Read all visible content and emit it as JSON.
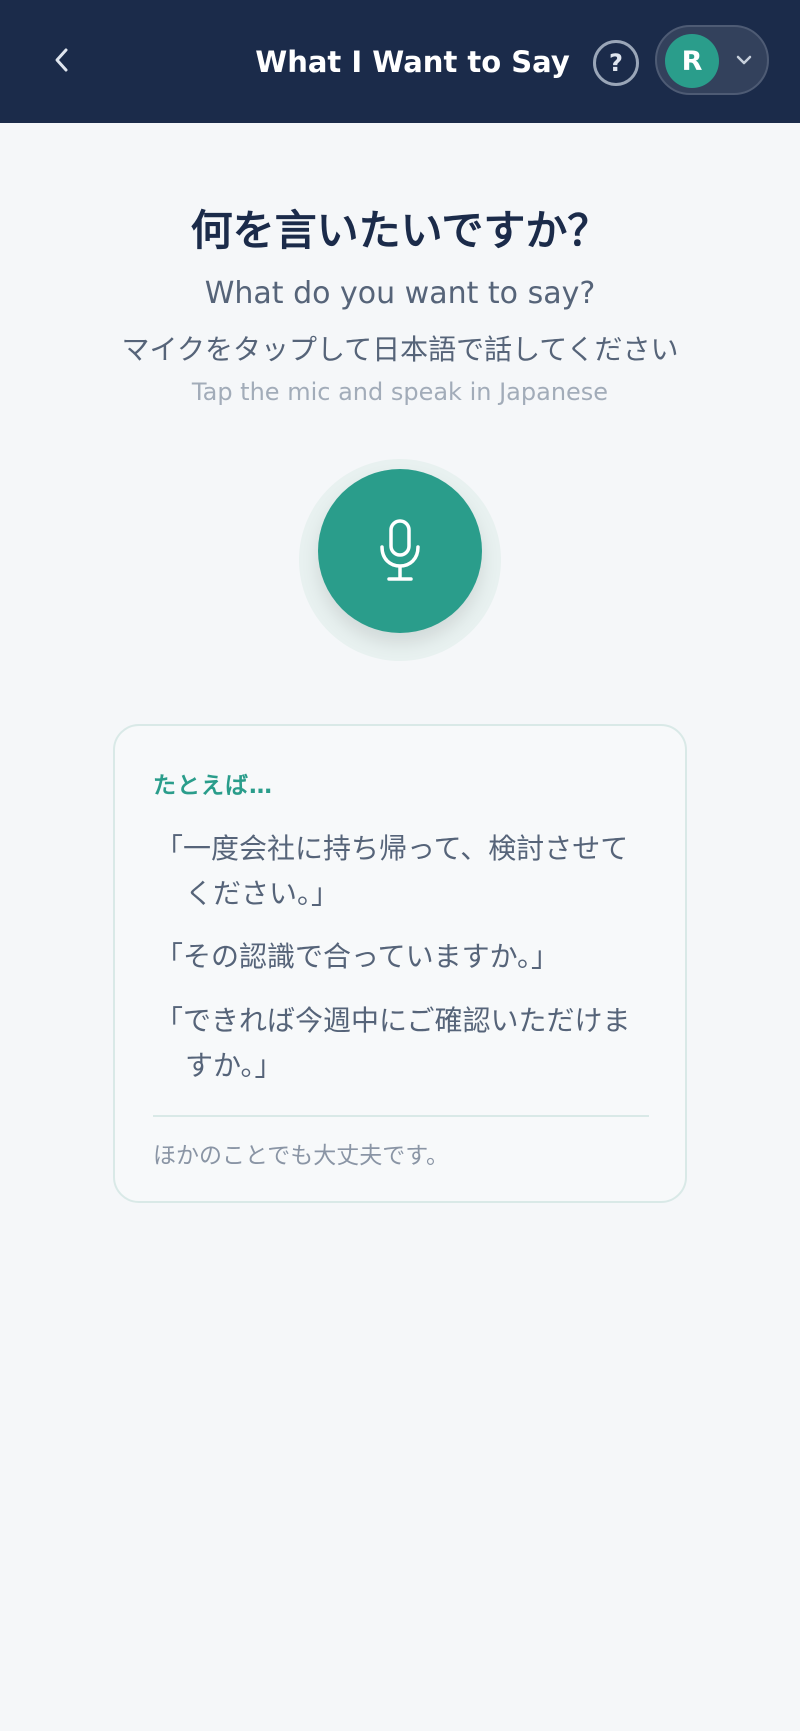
{
  "header": {
    "title": "What I Want to Say",
    "help_label": "?",
    "avatar_initial": "R"
  },
  "main": {
    "title_jp": "何を言いたいですか？",
    "subtitle_en": "What do you want to say?",
    "instruction_jp": "マイクをタップして日本語で話してください",
    "instruction_en": "Tap the mic and speak in Japanese"
  },
  "examples": {
    "heading": "たとえば…",
    "items": [
      "「一度会社に持ち帰って、検討させてください。」",
      "「その認識で合っていますか。」",
      "「できれば今週中にご確認いただけますか。」"
    ],
    "note": "ほかのことでも大丈夫です。"
  },
  "colors": {
    "header_bg": "#1b2b4a",
    "accent": "#2a9d8b",
    "page_bg": "#f5f7f9"
  },
  "icons": {
    "back": "chevron-left-icon",
    "help": "help-icon",
    "dropdown": "chevron-down-icon",
    "mic": "microphone-icon"
  }
}
